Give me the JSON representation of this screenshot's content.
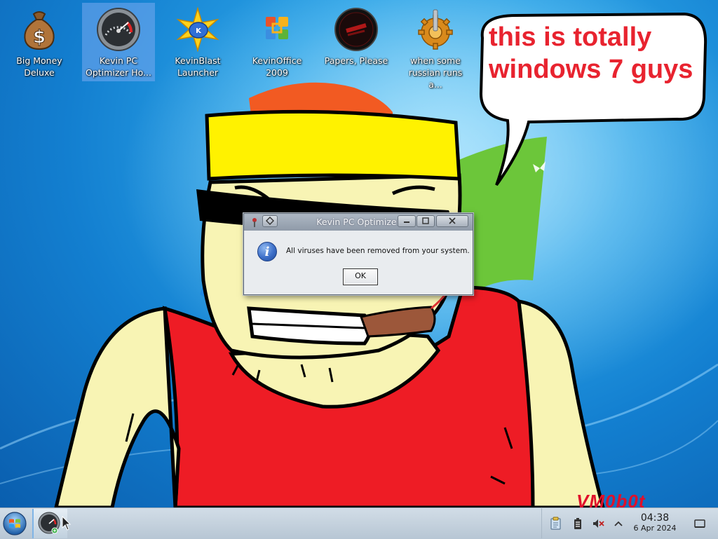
{
  "desktop": {
    "icons": [
      {
        "label": "Big Money\nDeluxe",
        "icon": "money-bag-icon"
      },
      {
        "label": "Kevin PC\nOptimizer Ho...",
        "icon": "speedometer-icon",
        "selected": true
      },
      {
        "label": "KevinBlast\nLauncher",
        "icon": "star-blast-icon"
      },
      {
        "label": "KevinOffice\n2009",
        "icon": "office-logo-icon"
      },
      {
        "label": "Papers, Please",
        "icon": "papers-please-icon"
      },
      {
        "label": "when some\nrussian runs a...",
        "icon": "gear-joystick-icon"
      }
    ],
    "speech_bubble_text": "this is totally\nwindows 7 guys",
    "watermark": "VM0b0t"
  },
  "dialog": {
    "title": "Kevin PC Optimizer",
    "message": "All viruses have been removed from your system.",
    "ok_label": "OK",
    "icon": "info-icon"
  },
  "taskbar": {
    "start_icon": "windows-start-icon",
    "tasks": [
      {
        "app": "Kevin PC Optimizer",
        "icon": "speedometer-icon"
      }
    ],
    "tray": [
      "clipboard-icon",
      "battery-icon",
      "volume-muted-icon",
      "chevron-up-icon"
    ],
    "clock_time": "04:38",
    "clock_date": "6 Apr 2024",
    "show_desktop_icon": "show-desktop-icon"
  },
  "colors": {
    "desktop_blue": "#137fd0",
    "bubble_text": "#e8232f",
    "shirt_red": "#ee1c25",
    "headband_yellow": "#fff200",
    "skin": "#f8f4b4"
  }
}
